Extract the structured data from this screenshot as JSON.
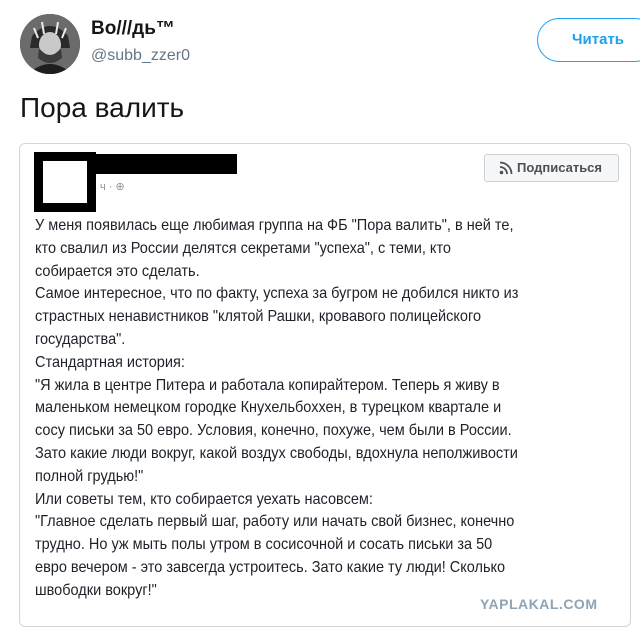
{
  "header": {
    "display_name": "Во///дь™",
    "handle": "@subb_zzer0",
    "follow_label": "Читать"
  },
  "tweet": {
    "text": "Пора валить"
  },
  "embedded_post": {
    "meta": "ч · ⊕",
    "subscribe_label": "Подписаться",
    "lines": [
      "У меня появилась еще любимая группа на ФБ \"Пора валить\", в ней те,",
      "кто свалил из России делятся секретами \"успеха\", с теми, кто",
      "собирается это сделать.",
      "Самое интересное, что по факту, успеха за бугром не добился никто из",
      "страстных ненавистников \"клятой Рашки, кровавого полицейского",
      "государства\".",
      "Стандартная история:",
      "\"Я жила в центре Питера и работала копирайтером. Теперь я живу в",
      "маленьком немецком городке Кнухельбоххен, в турецком квартале и",
      "сосу письки за 50 евро. Условия, конечно, похуже, чем были в России.",
      "Зато какие люди вокруг, какой воздух свободы, вдохнула неполживости",
      "полной грудью!\"",
      "Или советы тем, кто собирается уехать насовсем:",
      "\"Главное сделать первый шаг, работу или начать свой бизнес, конечно",
      "трудно. Но уж мыть полы утром в сосисочной и сосать письки за 50",
      "евро вечером - это завсегда устроитесь. Зато какие ту люди! Сколько",
      "швободки вокруг!\""
    ]
  },
  "watermark": "YAPLAKAL.COM",
  "colors": {
    "accent": "#1da1f2",
    "handle_gray": "#657786",
    "watermark": "#8ea3b4"
  }
}
